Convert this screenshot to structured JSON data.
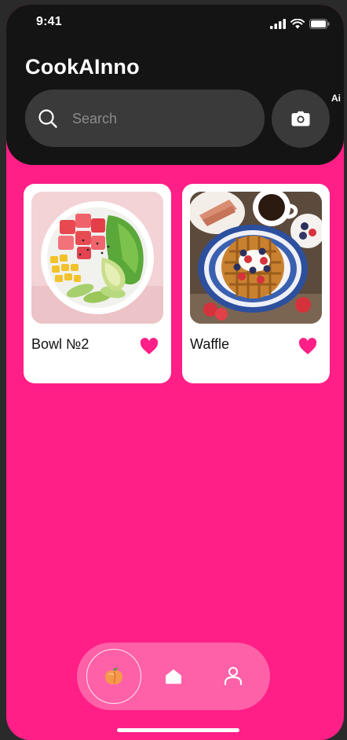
{
  "status_bar": {
    "time": "9:41"
  },
  "header": {
    "app_title": "CookAInno",
    "search": {
      "placeholder": "Search"
    },
    "camera_button": {
      "icon": "camera-icon"
    },
    "ai_badge": "Ai"
  },
  "recipes": [
    {
      "name": "Bowl №2",
      "favorite": true,
      "image": "poke-bowl-photo"
    },
    {
      "name": "Waffle",
      "favorite": true,
      "image": "waffle-photo"
    }
  ],
  "bottom_nav": {
    "items": [
      {
        "icon": "peach-icon",
        "active": true
      },
      {
        "icon": "home-icon",
        "active": false
      },
      {
        "icon": "profile-icon",
        "active": false
      }
    ]
  },
  "colors": {
    "accent": "#ff1f86",
    "header_bg": "#141414",
    "heart": "#ff1f86",
    "nav_bg": "#ff61a8"
  }
}
